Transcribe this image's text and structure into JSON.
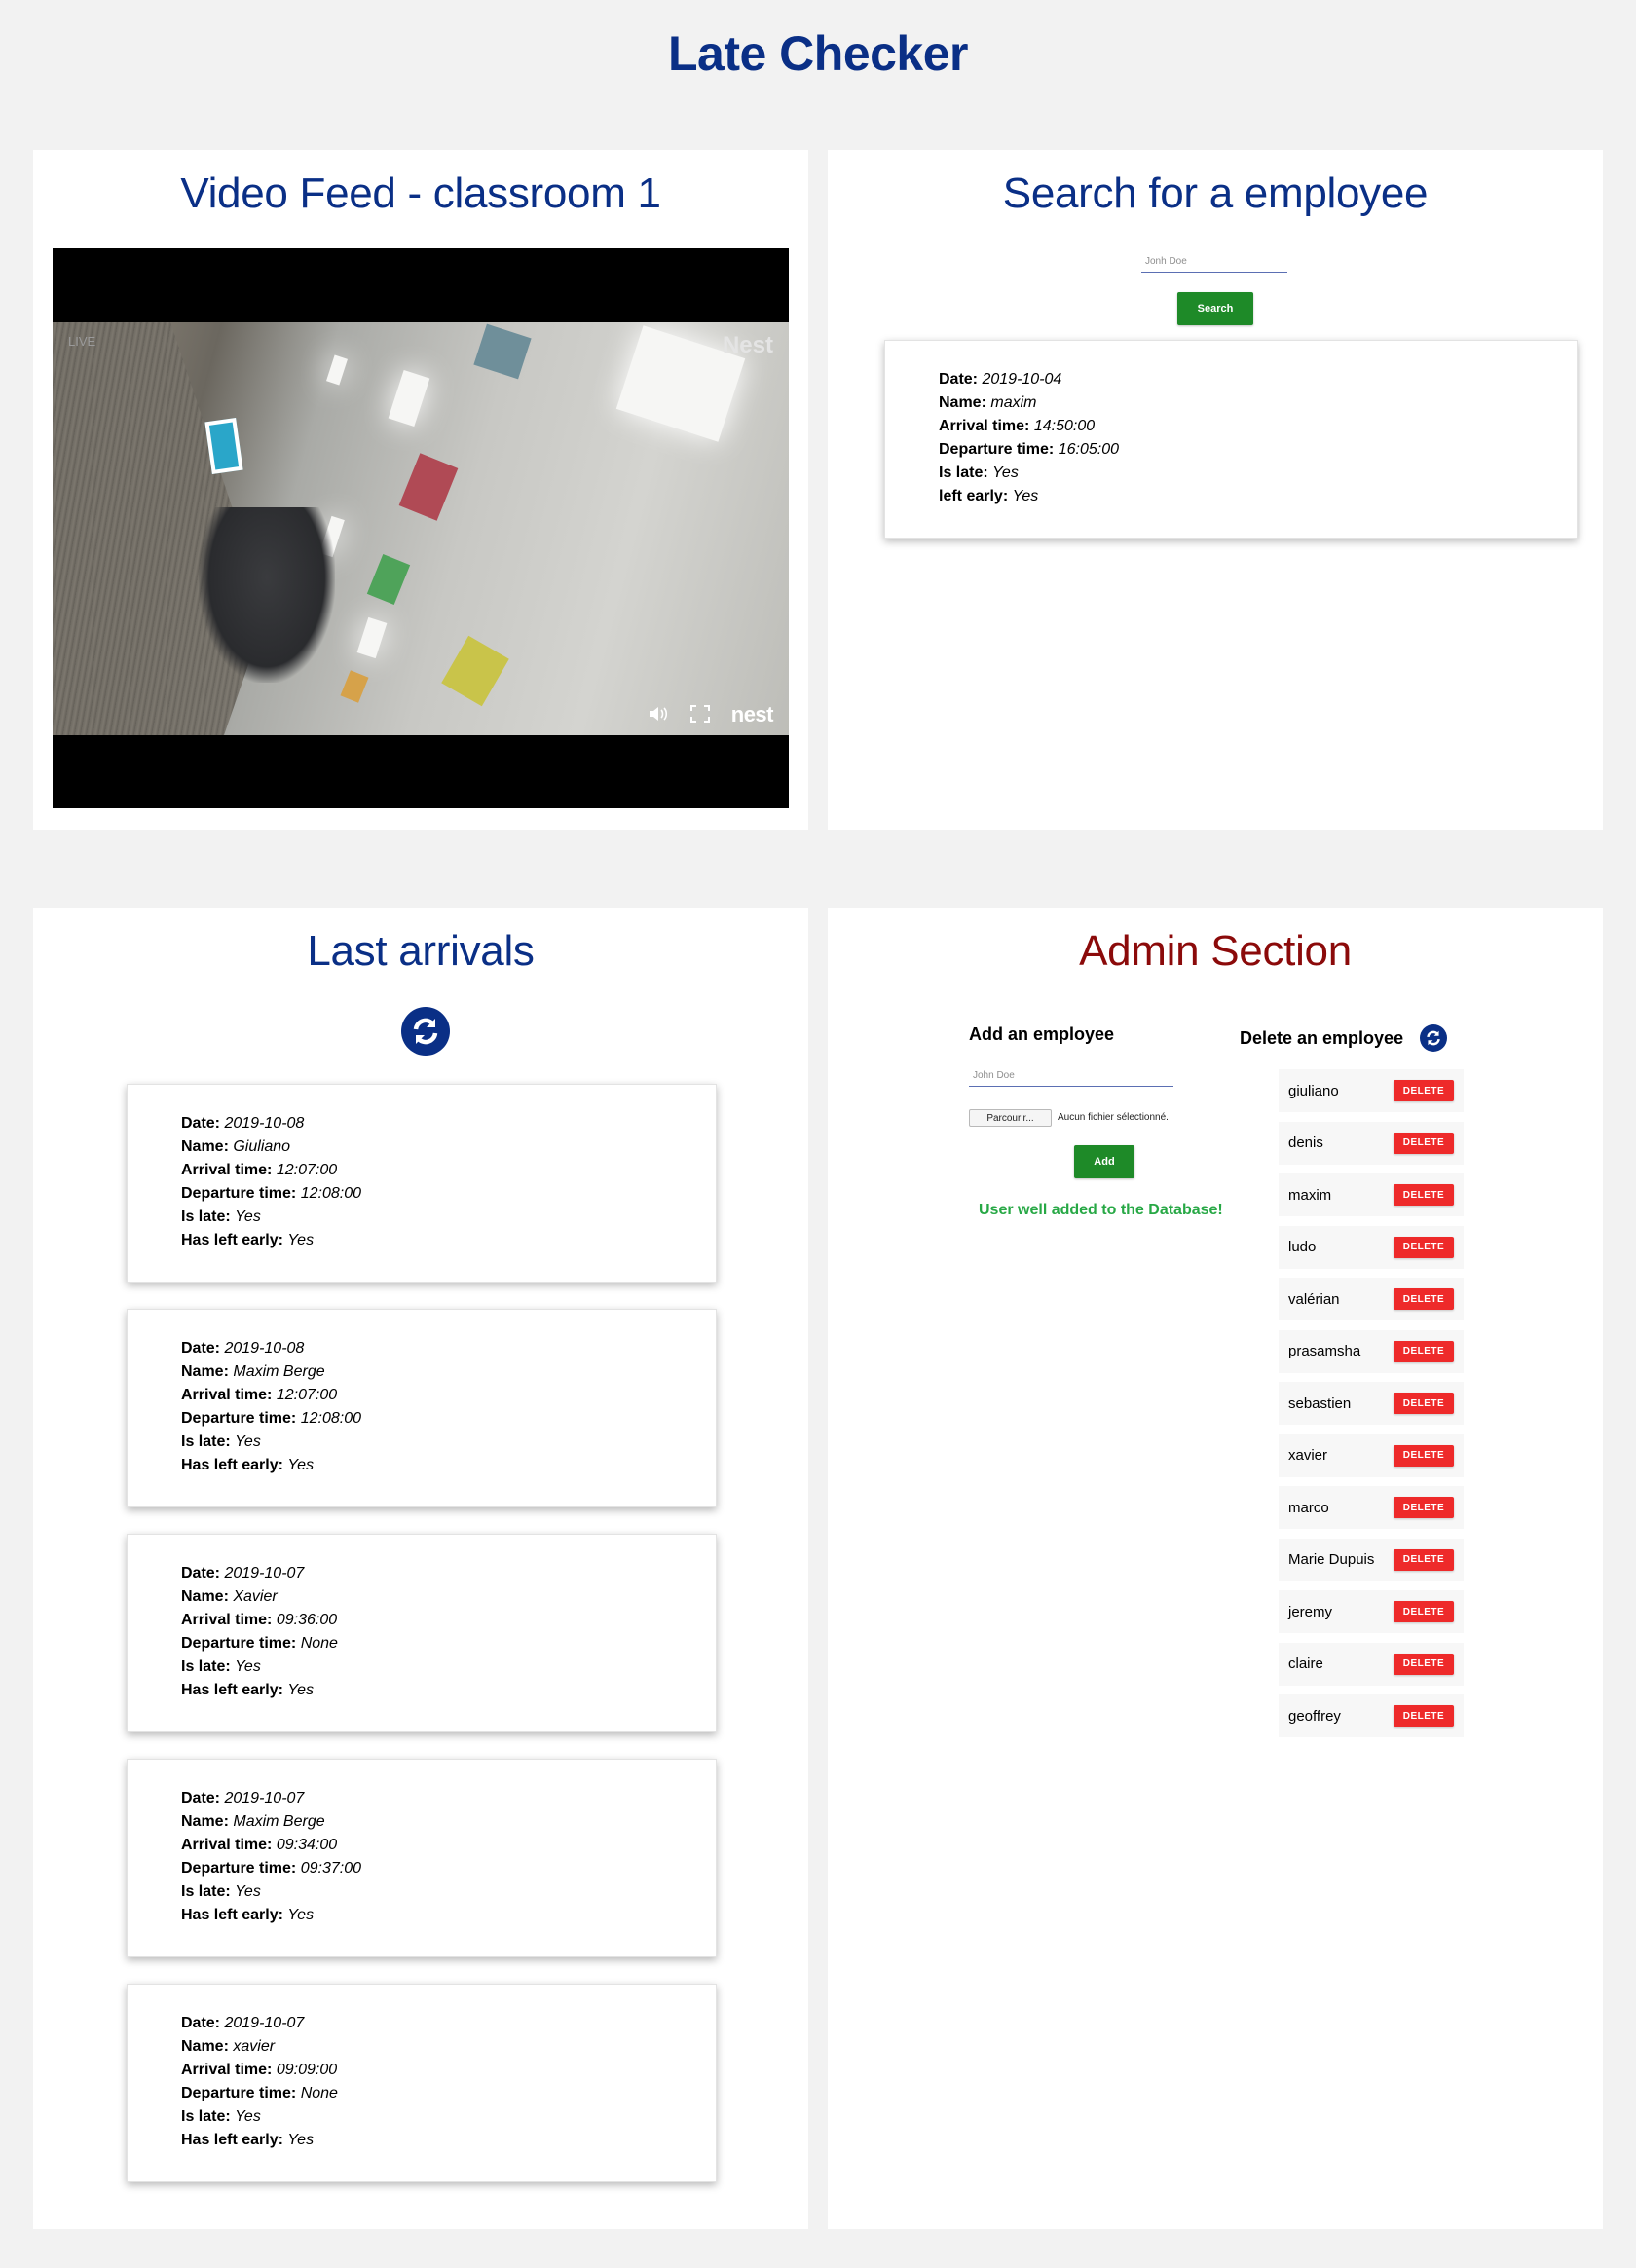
{
  "app": {
    "title": "Late Checker"
  },
  "video": {
    "title": "Video Feed - classroom 1",
    "live_label": "LIVE",
    "brand_top": "Nest",
    "brand_logo": "nest",
    "icons": [
      "volume-icon",
      "fullscreen-icon"
    ]
  },
  "search": {
    "title": "Search for a employee",
    "placeholder": "Jonh Doe",
    "button_label": "Search",
    "result": {
      "date_label": "Date:",
      "date": "2019-10-04",
      "name_label": "Name:",
      "name": "maxim",
      "arrival_label": "Arrival time:",
      "arrival": "14:50:00",
      "departure_label": "Departure time:",
      "departure": "16:05:00",
      "late_label": "Is late:",
      "late": "Yes",
      "left_label": "left early:",
      "left": "Yes"
    }
  },
  "arrivals": {
    "title": "Last arrivals",
    "labels": {
      "date": "Date:",
      "name": "Name:",
      "arrival": "Arrival time:",
      "departure": "Departure time:",
      "late": "Is late:",
      "left": "Has left early:"
    },
    "items": [
      {
        "date": "2019-10-08",
        "name": "Giuliano",
        "arrival": "12:07:00",
        "departure": "12:08:00",
        "late": "Yes",
        "left": "Yes"
      },
      {
        "date": "2019-10-08",
        "name": "Maxim Berge",
        "arrival": "12:07:00",
        "departure": "12:08:00",
        "late": "Yes",
        "left": "Yes"
      },
      {
        "date": "2019-10-07",
        "name": "Xavier",
        "arrival": "09:36:00",
        "departure": "None",
        "late": "Yes",
        "left": "Yes"
      },
      {
        "date": "2019-10-07",
        "name": "Maxim Berge",
        "arrival": "09:34:00",
        "departure": "09:37:00",
        "late": "Yes",
        "left": "Yes"
      },
      {
        "date": "2019-10-07",
        "name": "xavier",
        "arrival": "09:09:00",
        "departure": "None",
        "late": "Yes",
        "left": "Yes"
      }
    ]
  },
  "admin": {
    "title": "Admin Section",
    "add_title": "Add an employee",
    "add_placeholder": "John Doe",
    "file_button": "Parcourir...",
    "file_status": "Aucun fichier sélectionné.",
    "add_button": "Add",
    "success": "User well added to the Database!",
    "delete_title": "Delete an employee",
    "delete_button": "DELETE",
    "employees": [
      "giuliano",
      "denis",
      "maxim",
      "ludo",
      "valérian",
      "prasamsha",
      "sebastien",
      "xavier",
      "marco",
      "Marie Dupuis",
      "jeremy",
      "claire",
      "geoffrey"
    ]
  },
  "colors": {
    "heading": "#0a2f86",
    "admin_heading": "#8b0a0a",
    "button_green": "#1e8a28",
    "button_delete": "#ee2a2a",
    "success": "#27a845",
    "background": "#f2f2f2"
  }
}
